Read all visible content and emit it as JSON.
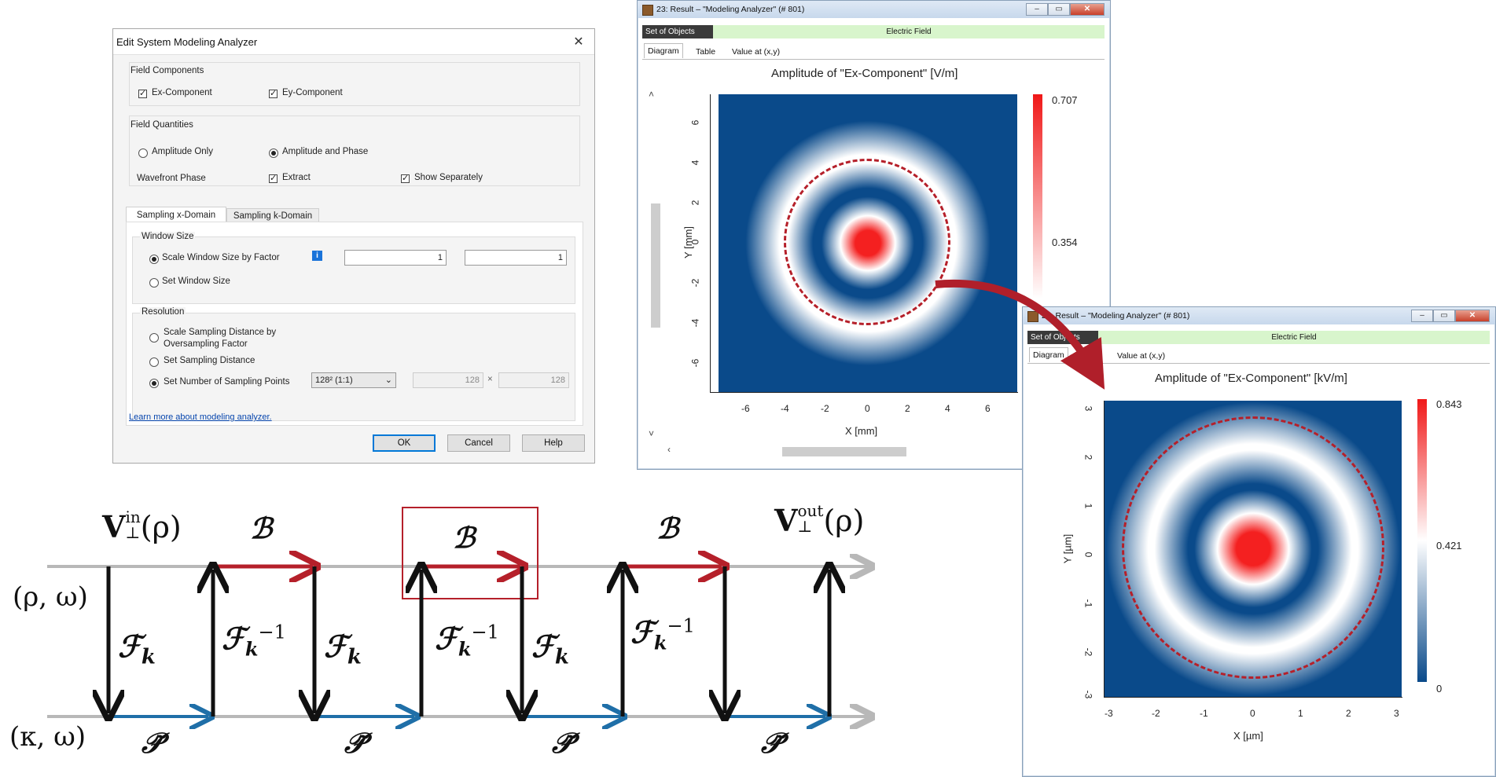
{
  "dialog": {
    "title": "Edit System Modeling Analyzer",
    "field_components": {
      "label": "Field Components",
      "ex": "Ex-Component",
      "ey": "Ey-Component"
    },
    "field_quantities": {
      "label": "Field Quantities",
      "amplitude_only": "Amplitude Only",
      "amplitude_phase": "Amplitude and Phase",
      "wavefront_phase": "Wavefront Phase",
      "extract": "Extract",
      "show_separately": "Show Separately"
    },
    "tabs": [
      "Sampling x-Domain",
      "Sampling k-Domain"
    ],
    "window_size": {
      "label": "Window Size",
      "scale_by_factor": "Scale Window Size by Factor",
      "set_size": "Set Window Size",
      "factor_x": "1",
      "factor_y": "1"
    },
    "resolution": {
      "label": "Resolution",
      "scale_sampling_1": "Scale Sampling Distance by",
      "scale_sampling_2": "Oversampling Factor",
      "set_sampling_distance": "Set Sampling Distance",
      "set_number_points": "Set Number of Sampling Points",
      "select_value": "128² (1:1)",
      "points_x": "128",
      "times": "×",
      "points_y": "128"
    },
    "learn_more": "Learn more about modeling analyzer.",
    "ok": "OK",
    "cancel": "Cancel",
    "help": "Help"
  },
  "result1": {
    "title": "23: Result – \"Modeling Analyzer\" (# 801)",
    "set_of_objects": "Set of Objects",
    "electric_field": "Electric Field",
    "tabs": [
      "Diagram",
      "Table",
      "Value at (x,y)"
    ],
    "plot_title": "Amplitude of \"Ex-Component\"  [V/m]",
    "xlabel": "X [mm]",
    "ylabel": "Y [mm]",
    "xticks": [
      "-6",
      "-4",
      "-2",
      "0",
      "2",
      "4",
      "6"
    ],
    "yticks": [
      "6",
      "4",
      "2",
      "0",
      "-2",
      "-4",
      "-6"
    ],
    "colorbar": [
      "0.707",
      "0.354"
    ]
  },
  "result2": {
    "title": "23: Result – \"Modeling Analyzer\" (# 801)",
    "set_of_objects": "Set of Objects",
    "electric_field": "Electric Field",
    "tabs": [
      "Diagram",
      "Table",
      "Value at (x,y)"
    ],
    "plot_title": "Amplitude of \"Ex-Component\"  [kV/m]",
    "xlabel": "X [µm]",
    "ylabel": "Y [µm]",
    "xticks": [
      "-3",
      "-2",
      "-1",
      "0",
      "1",
      "2",
      "3"
    ],
    "yticks": [
      "3",
      "2",
      "1",
      "0",
      "-1",
      "-2",
      "-3"
    ],
    "colorbar": [
      "0.843",
      "0.421",
      "0"
    ]
  },
  "diagram": {
    "v_in": "V",
    "v_in_sup": "in",
    "v_in_sub": "⊥",
    "v_in_arg": "(ρ)",
    "v_out": "V",
    "v_out_sup": "out",
    "v_out_sub": "⊥",
    "v_out_arg": "(ρ)",
    "rho_omega": "(ρ, ω)",
    "kappa_omega": "(κ, ω)",
    "B": "ℬ",
    "F": "ℱ",
    "k": "k",
    "inv": "−1",
    "P": "𝒫̃"
  },
  "colors": {
    "red_arrow": "#b5202a",
    "blue_arrow": "#1f6fa8",
    "map_blue": "#0a4a8a",
    "map_red": "#f01818"
  }
}
